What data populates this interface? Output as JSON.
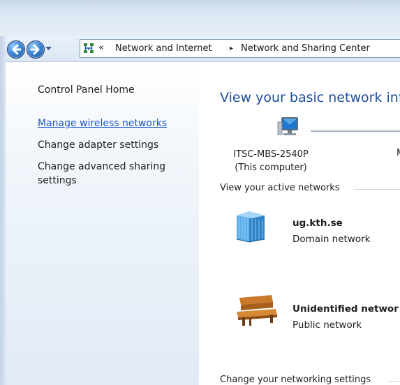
{
  "window": {
    "address_bar": {
      "overflow_chevron": "«",
      "crumbs": [
        "Network and Internet",
        "Network and Sharing Center"
      ],
      "separator": "▸"
    }
  },
  "sidebar": {
    "home": "Control Panel Home",
    "links": [
      "Manage wireless networks",
      "Change adapter settings",
      "Change advanced sharing",
      "settings"
    ]
  },
  "main": {
    "title": "View your basic network inf",
    "computer": {
      "name": "ITSC-MBS-2540P",
      "subtitle": "(This computer)",
      "next_node_cut": "M"
    },
    "active_networks_label": "View your active networks",
    "networks": [
      {
        "name": "ug.kth.se",
        "type": "Domain network",
        "icon": "building-icon"
      },
      {
        "name": "Unidentified networ",
        "type": "Public network",
        "icon": "park-bench-icon"
      }
    ],
    "change_settings_label": "Change your networking settings"
  },
  "colors": {
    "title_blue": "#1e4e9a",
    "link_blue": "#1a56c9"
  }
}
